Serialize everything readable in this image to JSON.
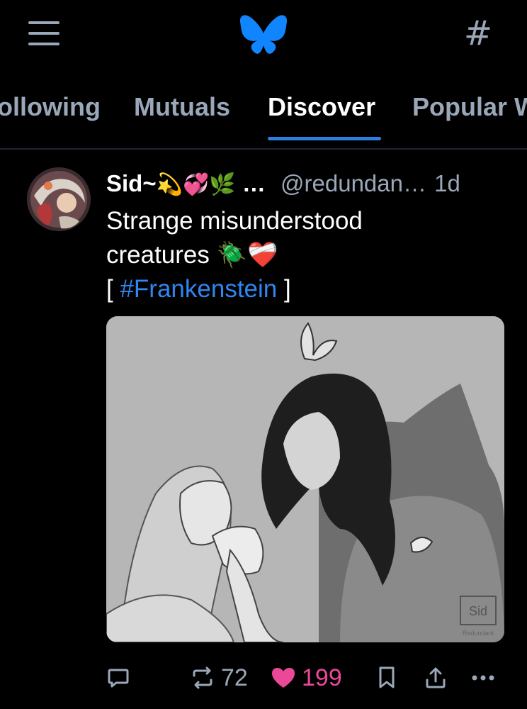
{
  "header": {
    "menu_icon": "hamburger-menu-icon",
    "logo": "bluesky-butterfly-logo",
    "feeds_icon": "hashtag-icon",
    "feeds_glyph": "#",
    "accent_color": "#1185fe"
  },
  "tabs": [
    {
      "label": "Following",
      "shown": "ollowing",
      "active": false
    },
    {
      "label": "Mutuals",
      "active": false
    },
    {
      "label": "Discover",
      "active": true
    },
    {
      "label": "Popular W",
      "active": false
    }
  ],
  "post": {
    "author_name": "Sid~",
    "author_emojis": "💫💞🌿",
    "ellipsis": "…",
    "handle": "@redundan…",
    "timestamp": "1d",
    "text_line1": "Strange misunderstood",
    "text_line2_text": "creatures",
    "text_line2_emojis": "🪲❤️‍🩹",
    "text_line3_open": "[ ",
    "hashtag": "#Frankenstein",
    "text_line3_close": " ]",
    "image_signature": "Sid",
    "image_signature_sub": "Redundant",
    "reply_icon": "reply-bubble-icon",
    "repost_icon": "repost-icon",
    "repost_count": "72",
    "like_icon": "heart-icon",
    "like_count": "199",
    "like_color": "#ec4899",
    "bookmark_icon": "bookmark-icon",
    "share_icon": "share-icon",
    "more_icon": "more-dots-icon"
  }
}
